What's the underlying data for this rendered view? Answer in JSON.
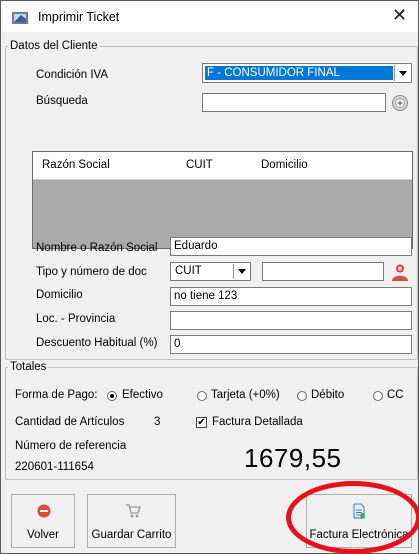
{
  "window": {
    "title": "Imprimir Ticket"
  },
  "cliente": {
    "legend": "Datos del Cliente",
    "condicion_label": "Condición IVA",
    "condicion_value": "F - CONSUMIDOR FINAL",
    "busqueda_label": "Búsqueda",
    "busqueda_value": "",
    "grid_headers": [
      "Razón Social",
      "CUIT",
      "Domicilio"
    ],
    "nombre_label": "Nombre o Razón Social",
    "nombre_value": "Eduardo",
    "tipo_doc_label": "Tipo y número de doc",
    "tipo_doc_value": "CUIT",
    "numero_doc_value": "",
    "domicilio_label": "Domicilio",
    "domicilio_value": "no tiene 123",
    "loc_label": "Loc. - Provincia",
    "loc_value": "",
    "descuento_label": "Descuento Habitual (%)",
    "descuento_value": "0"
  },
  "totales": {
    "legend": "Totales",
    "forma_pago_label": "Forma de Pago:",
    "payment_options": [
      "Efectivo",
      "Tarjeta (+0%)",
      "Débito",
      "CC"
    ],
    "selected_payment": "Efectivo",
    "cantidad_label": "Cantidad de Artículos",
    "cantidad_value": "3",
    "factura_detallada_label": "Factura Detallada",
    "factura_detallada_checked": true,
    "referencia_label": "Número de referencia",
    "referencia_value": "220601-111654",
    "total_value": "1679,55"
  },
  "buttons": {
    "volver": "Volver",
    "guardar": "Guardar Carrito",
    "factura": "Factura Electrónica"
  },
  "colors": {
    "selection": "#0078d7",
    "annotation": "#e8101a",
    "volver_icon": "#e34a3a",
    "factura_icon": "#3a7bd5"
  }
}
